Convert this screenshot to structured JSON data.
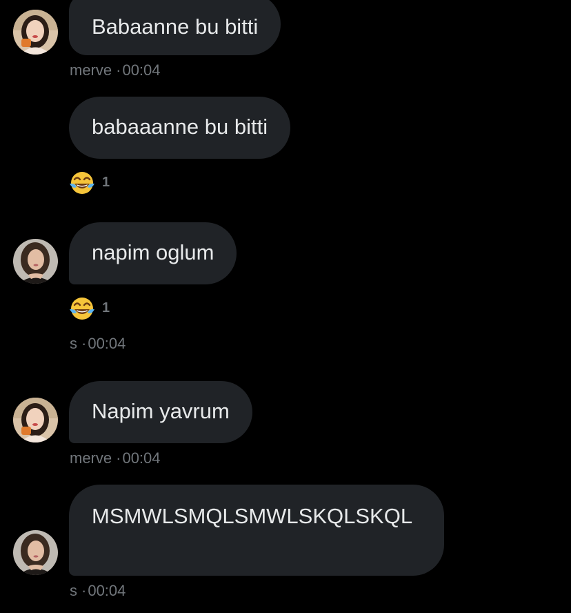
{
  "theme": {
    "background": "#000000",
    "bubble": "#202327",
    "text": "#e7e9ea",
    "muted": "#71767b"
  },
  "messages": [
    {
      "sender": "merve",
      "text": "Babaanne bu bitti",
      "avatar": "merve-avatar"
    },
    {
      "text": "babaaanne bu bitti",
      "reaction": {
        "emoji": "face-with-tears-of-joy-icon",
        "count": "1"
      }
    },
    {
      "sender": "s",
      "text": "napim oglum",
      "avatar": "s-avatar",
      "reaction": {
        "emoji": "face-with-tears-of-joy-icon",
        "count": "1"
      }
    },
    {
      "sender": "merve",
      "text": "Napim yavrum",
      "avatar": "merve-avatar"
    },
    {
      "sender": "s",
      "text": "MSMWLSMQLSMWLSKQLSKQL",
      "avatar": "s-avatar"
    }
  ],
  "meta": [
    {
      "name": "merve",
      "time": "00:04"
    },
    {
      "name": "s",
      "time": "00:04"
    },
    {
      "name": "merve",
      "time": "00:04"
    },
    {
      "name": "s",
      "time": "00:04"
    }
  ],
  "separator": "·"
}
